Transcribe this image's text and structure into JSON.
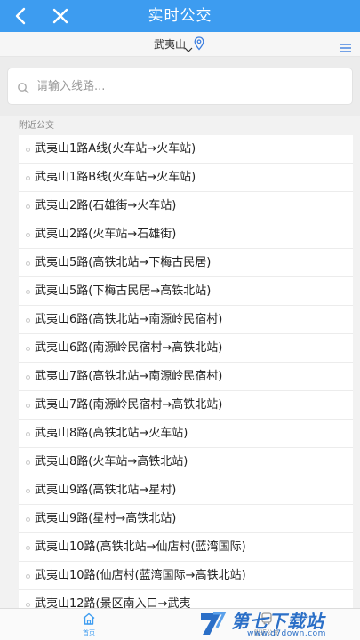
{
  "header": {
    "title": "实时公交",
    "back_icon": "back-arrow-icon",
    "close_icon": "close-icon",
    "background": "#3d9cf0"
  },
  "city": {
    "name": "武夷山",
    "dropdown_icon": "chevron-down-icon",
    "location_icon": "location-pin-icon",
    "menu_icon": "menu-icon"
  },
  "search": {
    "placeholder": "请输入线路...",
    "value": "",
    "icon": "search-icon"
  },
  "nearby": {
    "section_title": "附近公交",
    "routes": [
      "武夷山1路A线(火车站→火车站)",
      "武夷山1路B线(火车站→火车站)",
      "武夷山2路(石雄街→火车站)",
      "武夷山2路(火车站→石雄街)",
      "武夷山5路(高铁北站→下梅古民居)",
      "武夷山5路(下梅古民居→高铁北站)",
      "武夷山6路(高铁北站→南源岭民宿村)",
      "武夷山6路(南源岭民宿村→高铁北站)",
      "武夷山7路(高铁北站→南源岭民宿村)",
      "武夷山7路(南源岭民宿村→高铁北站)",
      "武夷山8路(高铁北站→火车站)",
      "武夷山8路(火车站→高铁北站)",
      "武夷山9路(高铁北站→星村)",
      "武夷山9路(星村→高铁北站)",
      "武夷山10路(高铁北站→仙店村(蓝湾国际)",
      "武夷山10路(仙店村(蓝湾国际→高铁北站)",
      "武夷山12路(景区南入口→武夷"
    ]
  },
  "tabbar": {
    "home_label": "首页",
    "home_icon": "home-icon",
    "other_label": "附近公交",
    "other_icon": "bus-icon",
    "active_color": "#3d9cf0"
  },
  "watermark": {
    "text": "第七下载站",
    "url": "www.d7down.com",
    "logo": "d7-logo"
  }
}
